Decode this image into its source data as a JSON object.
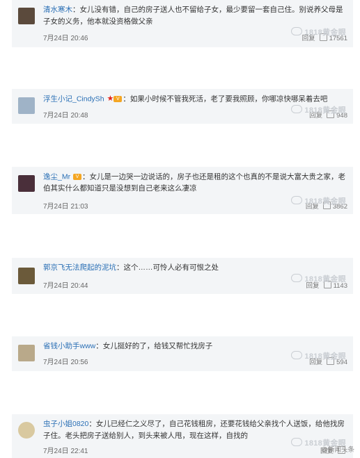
{
  "watermark": "1818黄金眼",
  "reply_label": "回复",
  "comments": [
    {
      "username": "清水寒木",
      "text": "：女儿没有错，自己的房子送人也不留给子女，最少要留一套自己住。别说养父母是子女的义务，他本就没资格做父亲",
      "time": "7月24日 20:46",
      "likes": "17561",
      "avatar_color": "#5b4a3c"
    },
    {
      "username": "浮生小记_CindySh",
      "text": "：如果小时候不管我死活，老了要我照顾，你哪凉快哪呆着去吧",
      "time": "7月24日 20:48",
      "likes": "948",
      "avatar_color": "#9fb3c7"
    },
    {
      "username": "逸尘_Mr",
      "text": "：女儿是一边哭一边说话的，房子也还是租的这个也真的不是说大富大贵之家，老伯其实什么都知道只是没想到自己老来这么凄凉",
      "time": "7月24日 21:03",
      "likes": "3862",
      "avatar_color": "#4a2f3a"
    },
    {
      "username": "郭京飞无法爬起的泥坑",
      "text": "：这个……可怜人必有可恨之处",
      "time": "7月24日 20:44",
      "likes": "1143",
      "avatar_color": "#6b5a3a"
    },
    {
      "username": "省钱小助手www",
      "text": "：女儿挺好的了，给钱又帮忙找房子",
      "time": "7月24日 20:56",
      "likes": "594",
      "avatar_color": "#b9a98a"
    },
    {
      "username": "虫子小姐0820",
      "text": "：女儿已经仁之义尽了，自己花钱租房，还要花钱给父亲找个人送饭，给他找房子住。老头把房子送给别人，到头来被人甩，现在这样，自找的",
      "time": "7月24日 22:41",
      "likes": "",
      "avatar_color": "#d9c9a0"
    }
  ],
  "bottom_watermark": "@新闻头条"
}
